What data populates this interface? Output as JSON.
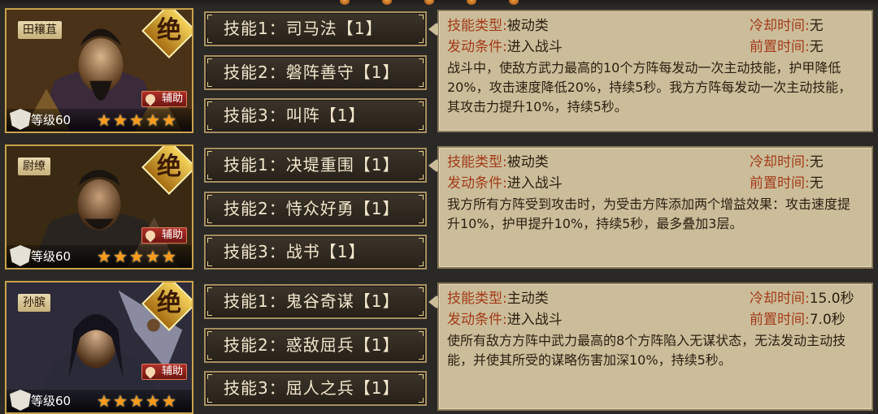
{
  "heroes": [
    {
      "name": "田穰苴",
      "rank": "绝",
      "role": "辅助",
      "level": "等级60",
      "stars": 5,
      "skills": [
        {
          "label": "技能1：司马法【1】"
        },
        {
          "label": "技能2：磐阵善守【1】"
        },
        {
          "label": "技能3：叫阵【1】"
        }
      ],
      "detail": {
        "type_label": "技能类型:",
        "type_value": "被动类",
        "cooldown_label": "冷却时间:",
        "cooldown_value": "无",
        "trigger_label": "发动条件:",
        "trigger_value": "进入战斗",
        "precast_label": "前置时间:",
        "precast_value": "无",
        "description": "战斗中，使敌方武力最高的10个方阵每发动一次主动技能，护甲降低20%，攻击速度降低20%，持续5秒。我方方阵每发动一次主动技能，其攻击力提升10%，持续5秒。"
      }
    },
    {
      "name": "尉缭",
      "rank": "绝",
      "role": "辅助",
      "level": "等级60",
      "stars": 5,
      "skills": [
        {
          "label": "技能1：决堤重围【1】"
        },
        {
          "label": "技能2：恃众好勇【1】"
        },
        {
          "label": "技能3：战书【1】"
        }
      ],
      "detail": {
        "type_label": "技能类型:",
        "type_value": "被动类",
        "cooldown_label": "冷却时间:",
        "cooldown_value": "无",
        "trigger_label": "发动条件:",
        "trigger_value": "进入战斗",
        "precast_label": "前置时间:",
        "precast_value": "无",
        "description": "我方所有方阵受到攻击时，为受击方阵添加两个增益效果：攻击速度提升10%，护甲提升10%，持续5秒，最多叠加3层。"
      }
    },
    {
      "name": "孙膑",
      "rank": "绝",
      "role": "辅助",
      "level": "等级60",
      "stars": 5,
      "skills": [
        {
          "label": "技能1：鬼谷奇谋【1】"
        },
        {
          "label": "技能2：惑敌屈兵【1】"
        },
        {
          "label": "技能3：屈人之兵【1】"
        }
      ],
      "detail": {
        "type_label": "技能类型:",
        "type_value": "主动类",
        "cooldown_label": "冷却时间:",
        "cooldown_value": "15.0秒",
        "trigger_label": "发动条件:",
        "trigger_value": "进入战斗",
        "precast_label": "前置时间:",
        "precast_value": "7.0秒",
        "description": "使所有敌方方阵中武力最高的8个方阵陷入无谋状态，无法发动主动技能，并使其所受的谋略伤害加深10%，持续5秒。"
      }
    }
  ],
  "colors": {
    "background": "#2b2926",
    "panel": "#cbbd9a",
    "label_red": "#a43a18",
    "star_orange": "#ff9a1a",
    "frame_gold": "#c9a24a"
  }
}
